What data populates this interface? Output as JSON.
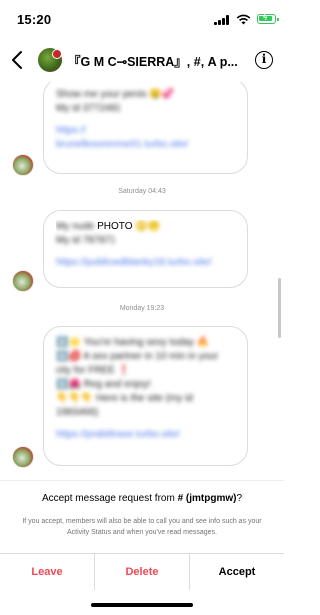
{
  "status_bar": {
    "time": "15:20"
  },
  "header": {
    "title": "『G M C⊸SIERRA』, #, A p...",
    "info_icon": "i"
  },
  "messages": [
    {
      "lines": [
        "Show me your penis 🤤💞",
        "My id 3772ڈ48",
        "",
        "https://",
        "brunellesorenme01.turbo.site/"
      ]
    },
    {
      "timestamp": "Saturday 04:43"
    },
    {
      "lines": [
        "My nude PHOTO 🙄😶",
        "My id 7ڈ8787",
        "",
        "https://publicwdblanky18.turbo.site/"
      ],
      "clear_word": "PHOTO"
    },
    {
      "timestamp": "Monday 19:23"
    },
    {
      "lines": [
        "⬇️🌟 You're having sexy today 🔥",
        "⬇️💋 A sex partner in 10 min in your",
        "city for FREE ❗",
        "⬇️🌺 Reg and enjoy!",
        "👇👇👇 Here is the site (my id",
        "1983466)",
        "",
        "https://prabittrase.turbo.site/"
      ]
    }
  ],
  "request": {
    "question_prefix": "Accept message request from ",
    "question_name": "# (jmtpgmw)",
    "question_suffix": "?",
    "info": "If you accept, members will also be able to call you and see info such as your Activity Status and when you've read messages."
  },
  "actions": {
    "leave": "Leave",
    "delete": "Delete",
    "accept": "Accept"
  },
  "colors": {
    "destructive": "#ed4956",
    "link": "#4f7ae8",
    "battery": "#34c759"
  }
}
